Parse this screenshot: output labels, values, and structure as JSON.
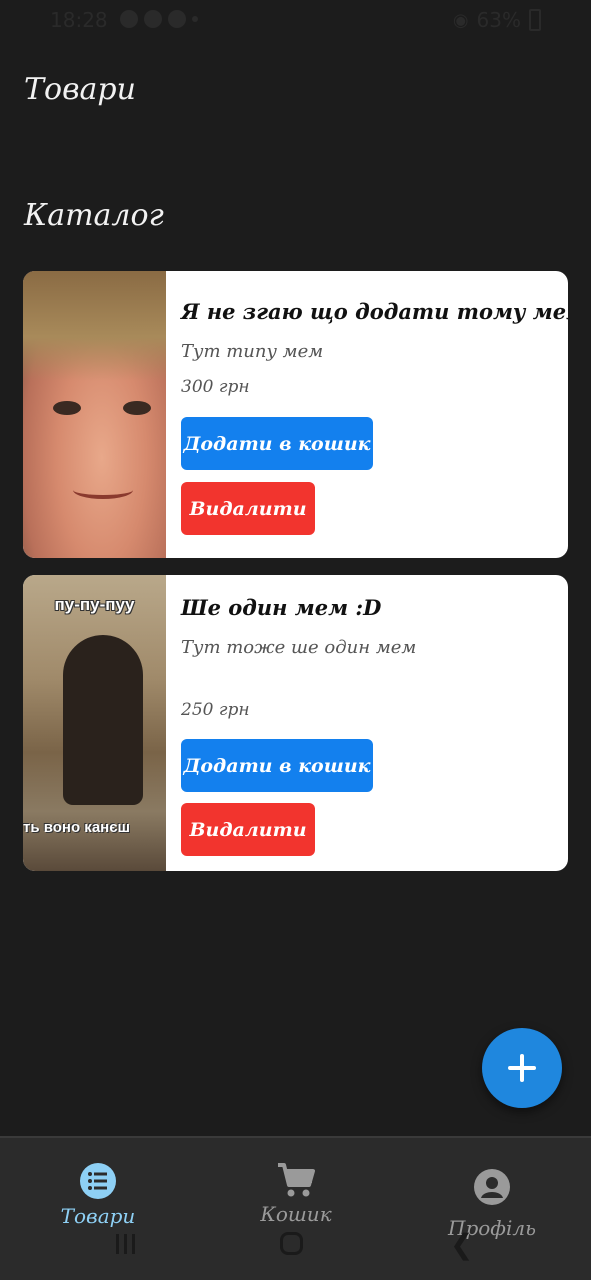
{
  "status_bar": {
    "time": "18:28",
    "battery": "63%"
  },
  "header": {
    "title": "Товари"
  },
  "section": {
    "title": "Каталог"
  },
  "products": [
    {
      "title": "Я не згаю що додати тому мем",
      "description": "Тут типу мем",
      "price": "300 грн",
      "add_label": "Додати в кошик",
      "delete_label": "Видалити"
    },
    {
      "title": "Ше один мем :D",
      "description": "Тут тоже ше один мем",
      "price": "250 грн",
      "add_label": "Додати в кошик",
      "delete_label": "Видалити",
      "image_caption_top": "пу-пу-пуу",
      "image_caption_bottom": "ть воно канєш"
    }
  ],
  "bottom_nav": {
    "items": [
      {
        "label": "Товари",
        "icon": "list-icon",
        "active": true
      },
      {
        "label": "Кошик",
        "icon": "cart-icon",
        "active": false
      },
      {
        "label": "Профіль",
        "icon": "profile-icon",
        "active": false
      }
    ]
  },
  "colors": {
    "background": "#1c1c1c",
    "primary": "#1380ee",
    "danger": "#f2342e",
    "fab": "#1f87de",
    "nav_active": "#8ed0f5"
  }
}
